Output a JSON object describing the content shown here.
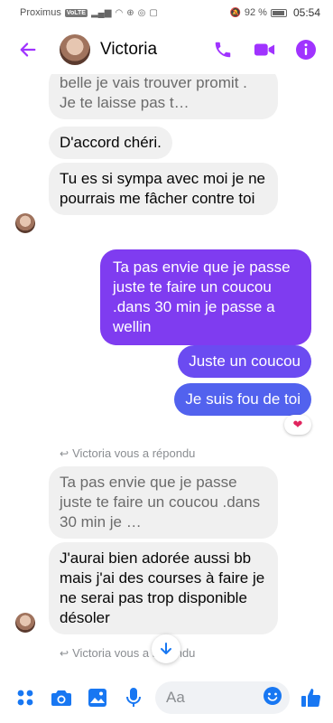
{
  "status_bar": {
    "carrier": "Proximus",
    "network_badge": "VoLTE",
    "battery": "92 %",
    "time": "05:54"
  },
  "header": {
    "contact_name": "Victoria",
    "icons": [
      "back-arrow-icon",
      "phone-icon",
      "video-icon",
      "info-icon"
    ],
    "accent_color": "#a033ff"
  },
  "messages": [
    {
      "id": "m1",
      "from": "them",
      "text": "belle je vais trouver promit . Je te laisse pas t…",
      "faded": true
    },
    {
      "id": "m2",
      "from": "them",
      "text": "D'accord chéri."
    },
    {
      "id": "m3",
      "from": "them",
      "text": "Tu es si sympa avec moi je ne pourrais me fâcher contre toi"
    },
    {
      "id": "m4",
      "from": "me",
      "text": "Ta pas envie que je passe juste te faire un coucou .dans 30 min je passe a wellin"
    },
    {
      "id": "m5",
      "from": "me",
      "text": "Juste un coucou"
    },
    {
      "id": "m6",
      "from": "me",
      "text": "Je suis fou de toi",
      "reaction": "❤"
    },
    {
      "id": "r1",
      "type": "reply_note",
      "text": "Victoria vous a répondu"
    },
    {
      "id": "m7",
      "from": "them",
      "text": "Ta pas envie que je passe juste te faire un coucou .dans 30 min je …",
      "faded": true,
      "quoted": true
    },
    {
      "id": "m8",
      "from": "them",
      "text": "J'aurai bien adorée aussi bb mais j'ai des courses à faire je ne serai pas trop disponible désoler"
    },
    {
      "id": "r2",
      "type": "reply_note",
      "text": "Victoria vous a répondu"
    }
  ],
  "composer": {
    "placeholder": "Aa",
    "icons": [
      "menu-grid-icon",
      "camera-icon",
      "gallery-icon",
      "microphone-icon",
      "emoji-icon",
      "thumbs-up-icon"
    ]
  }
}
